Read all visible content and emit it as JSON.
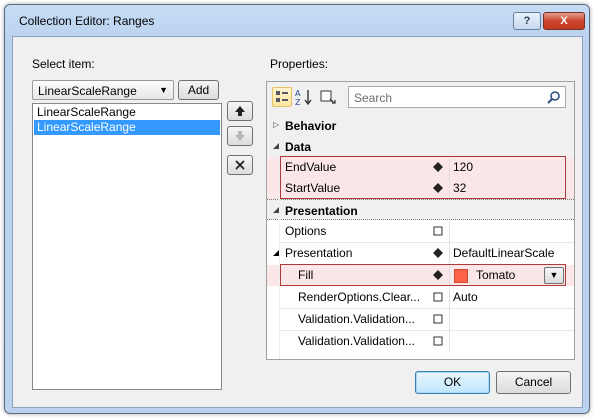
{
  "window": {
    "title": "Collection Editor: Ranges",
    "help_label": "?",
    "close_label": "X"
  },
  "left": {
    "select_label": "Select item:",
    "type_combo": "LinearScaleRange",
    "add_label": "Add",
    "items": [
      "LinearScaleRange",
      "LinearScaleRange"
    ],
    "selected_index": 1
  },
  "properties": {
    "label": "Properties:",
    "search_placeholder": "Search",
    "categories": {
      "behavior": "Behavior",
      "data": "Data",
      "presentation": "Presentation"
    },
    "rows": {
      "end_value": {
        "name": "EndValue",
        "value": "120"
      },
      "start_value": {
        "name": "StartValue",
        "value": "32"
      },
      "options": {
        "name": "Options",
        "value": ""
      },
      "presentation": {
        "name": "Presentation",
        "value": "DefaultLinearScale"
      },
      "fill": {
        "name": "Fill",
        "value": "Tomato",
        "color": "#ff6347"
      },
      "render_options": {
        "name": "RenderOptions.Clear...",
        "value": "Auto"
      },
      "validation1": {
        "name": "Validation.Validation...",
        "value": ""
      },
      "validation2": {
        "name": "Validation.Validation...",
        "value": ""
      }
    }
  },
  "footer": {
    "ok_label": "OK",
    "cancel_label": "Cancel"
  },
  "colors": {
    "accent": "#3399ff",
    "highlight_border": "#b03a3a",
    "highlight_fill": "#fbe7e7"
  }
}
